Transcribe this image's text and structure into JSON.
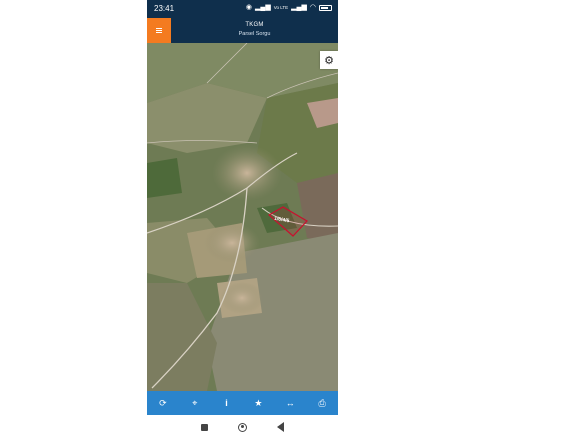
{
  "statusbar": {
    "time": "23:41",
    "network_label": "Vo LTE",
    "battery_icon": "battery-icon",
    "signal_icon": "signal-icon",
    "wifi_icon": "wifi-icon"
  },
  "appbar": {
    "title": "TKGM",
    "subtitle": "Parsel Sorgu",
    "menu_icon": "menu-icon"
  },
  "map": {
    "parcel_label": "1/6/4/5",
    "parcel_color": "#c8102e",
    "settings_icon": "gear-icon"
  },
  "toolbar": {
    "items": [
      {
        "icon": "refresh-icon",
        "glyph": "⟳"
      },
      {
        "icon": "locate-icon",
        "glyph": "⌖"
      },
      {
        "icon": "info-icon",
        "glyph": "i"
      },
      {
        "icon": "star-icon",
        "glyph": "★"
      },
      {
        "icon": "measure-icon",
        "glyph": "↔"
      },
      {
        "icon": "print-icon",
        "glyph": "⎙"
      }
    ]
  },
  "colors": {
    "appbar": "#0f2f4c",
    "accent": "#f47b20",
    "toolbar": "#2a84cc"
  }
}
